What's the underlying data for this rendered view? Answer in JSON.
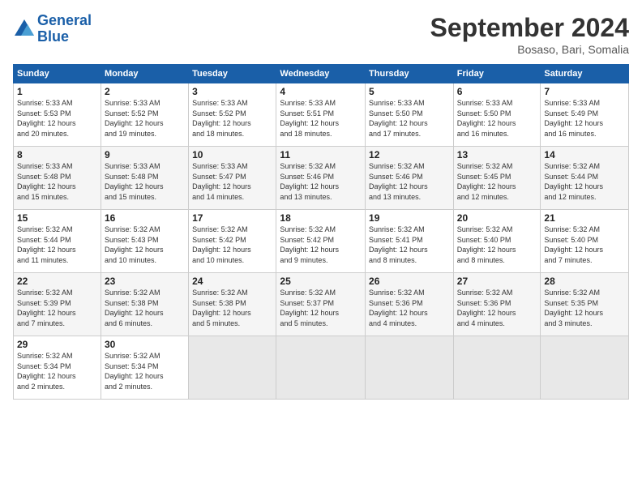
{
  "header": {
    "logo_line1": "General",
    "logo_line2": "Blue",
    "month_title": "September 2024",
    "subtitle": "Bosaso, Bari, Somalia"
  },
  "days_of_week": [
    "Sunday",
    "Monday",
    "Tuesday",
    "Wednesday",
    "Thursday",
    "Friday",
    "Saturday"
  ],
  "weeks": [
    [
      {
        "day": "1",
        "info": "Sunrise: 5:33 AM\nSunset: 5:53 PM\nDaylight: 12 hours\nand 20 minutes."
      },
      {
        "day": "2",
        "info": "Sunrise: 5:33 AM\nSunset: 5:52 PM\nDaylight: 12 hours\nand 19 minutes."
      },
      {
        "day": "3",
        "info": "Sunrise: 5:33 AM\nSunset: 5:52 PM\nDaylight: 12 hours\nand 18 minutes."
      },
      {
        "day": "4",
        "info": "Sunrise: 5:33 AM\nSunset: 5:51 PM\nDaylight: 12 hours\nand 18 minutes."
      },
      {
        "day": "5",
        "info": "Sunrise: 5:33 AM\nSunset: 5:50 PM\nDaylight: 12 hours\nand 17 minutes."
      },
      {
        "day": "6",
        "info": "Sunrise: 5:33 AM\nSunset: 5:50 PM\nDaylight: 12 hours\nand 16 minutes."
      },
      {
        "day": "7",
        "info": "Sunrise: 5:33 AM\nSunset: 5:49 PM\nDaylight: 12 hours\nand 16 minutes."
      }
    ],
    [
      {
        "day": "8",
        "info": "Sunrise: 5:33 AM\nSunset: 5:48 PM\nDaylight: 12 hours\nand 15 minutes."
      },
      {
        "day": "9",
        "info": "Sunrise: 5:33 AM\nSunset: 5:48 PM\nDaylight: 12 hours\nand 15 minutes."
      },
      {
        "day": "10",
        "info": "Sunrise: 5:33 AM\nSunset: 5:47 PM\nDaylight: 12 hours\nand 14 minutes."
      },
      {
        "day": "11",
        "info": "Sunrise: 5:32 AM\nSunset: 5:46 PM\nDaylight: 12 hours\nand 13 minutes."
      },
      {
        "day": "12",
        "info": "Sunrise: 5:32 AM\nSunset: 5:46 PM\nDaylight: 12 hours\nand 13 minutes."
      },
      {
        "day": "13",
        "info": "Sunrise: 5:32 AM\nSunset: 5:45 PM\nDaylight: 12 hours\nand 12 minutes."
      },
      {
        "day": "14",
        "info": "Sunrise: 5:32 AM\nSunset: 5:44 PM\nDaylight: 12 hours\nand 12 minutes."
      }
    ],
    [
      {
        "day": "15",
        "info": "Sunrise: 5:32 AM\nSunset: 5:44 PM\nDaylight: 12 hours\nand 11 minutes."
      },
      {
        "day": "16",
        "info": "Sunrise: 5:32 AM\nSunset: 5:43 PM\nDaylight: 12 hours\nand 10 minutes."
      },
      {
        "day": "17",
        "info": "Sunrise: 5:32 AM\nSunset: 5:42 PM\nDaylight: 12 hours\nand 10 minutes."
      },
      {
        "day": "18",
        "info": "Sunrise: 5:32 AM\nSunset: 5:42 PM\nDaylight: 12 hours\nand 9 minutes."
      },
      {
        "day": "19",
        "info": "Sunrise: 5:32 AM\nSunset: 5:41 PM\nDaylight: 12 hours\nand 8 minutes."
      },
      {
        "day": "20",
        "info": "Sunrise: 5:32 AM\nSunset: 5:40 PM\nDaylight: 12 hours\nand 8 minutes."
      },
      {
        "day": "21",
        "info": "Sunrise: 5:32 AM\nSunset: 5:40 PM\nDaylight: 12 hours\nand 7 minutes."
      }
    ],
    [
      {
        "day": "22",
        "info": "Sunrise: 5:32 AM\nSunset: 5:39 PM\nDaylight: 12 hours\nand 7 minutes."
      },
      {
        "day": "23",
        "info": "Sunrise: 5:32 AM\nSunset: 5:38 PM\nDaylight: 12 hours\nand 6 minutes."
      },
      {
        "day": "24",
        "info": "Sunrise: 5:32 AM\nSunset: 5:38 PM\nDaylight: 12 hours\nand 5 minutes."
      },
      {
        "day": "25",
        "info": "Sunrise: 5:32 AM\nSunset: 5:37 PM\nDaylight: 12 hours\nand 5 minutes."
      },
      {
        "day": "26",
        "info": "Sunrise: 5:32 AM\nSunset: 5:36 PM\nDaylight: 12 hours\nand 4 minutes."
      },
      {
        "day": "27",
        "info": "Sunrise: 5:32 AM\nSunset: 5:36 PM\nDaylight: 12 hours\nand 4 minutes."
      },
      {
        "day": "28",
        "info": "Sunrise: 5:32 AM\nSunset: 5:35 PM\nDaylight: 12 hours\nand 3 minutes."
      }
    ],
    [
      {
        "day": "29",
        "info": "Sunrise: 5:32 AM\nSunset: 5:34 PM\nDaylight: 12 hours\nand 2 minutes."
      },
      {
        "day": "30",
        "info": "Sunrise: 5:32 AM\nSunset: 5:34 PM\nDaylight: 12 hours\nand 2 minutes."
      },
      {
        "day": "",
        "info": ""
      },
      {
        "day": "",
        "info": ""
      },
      {
        "day": "",
        "info": ""
      },
      {
        "day": "",
        "info": ""
      },
      {
        "day": "",
        "info": ""
      }
    ]
  ]
}
